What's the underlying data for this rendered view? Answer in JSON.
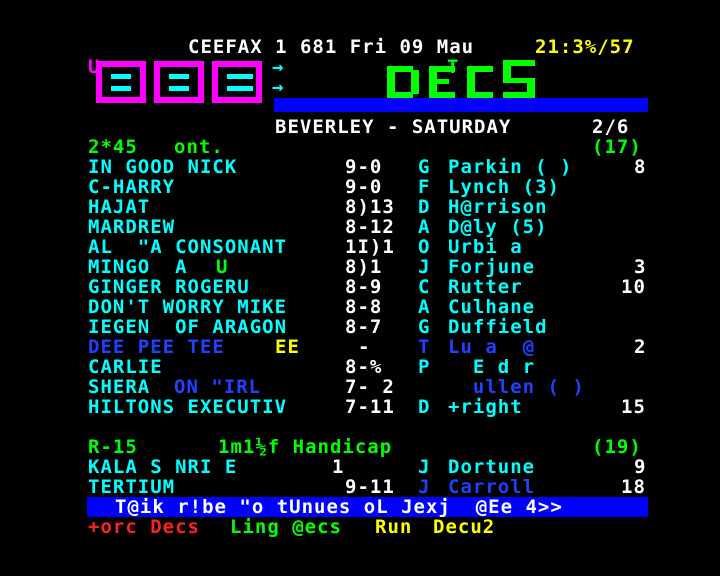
{
  "header": {
    "service": "CEEFAX 1 681 Fri 09 Mau",
    "clock": "21:3%/57"
  },
  "logos": {
    "bbc_prefix": "U",
    "bbc_arrows": [
      "→",
      "→"
    ],
    "section_superscript": "T",
    "section": "DECS"
  },
  "page": {
    "title": "BEVERLEY - SATURDAY",
    "page_number": "2/6"
  },
  "race1": {
    "time": "2*45",
    "label": "ont.",
    "runners": "(17)",
    "horses": [
      {
        "name": "IN GOOD NICK",
        "weight": "9-0",
        "draw": "G",
        "jockey": "Parkin ( )",
        "odds": "8"
      },
      {
        "name": "C-HARRY",
        "weight": "9-0",
        "draw": "F",
        "jockey": "Lynch (3)",
        "odds": ""
      },
      {
        "name": "HAJAT",
        "weight": "8)13",
        "draw": "D",
        "jockey": "H@rrison",
        "odds": ""
      },
      {
        "name": "MARDREW",
        "weight": "8-12",
        "draw": "A",
        "jockey": "D@ly (5)",
        "odds": ""
      },
      {
        "name": "AL  \"A CONSONANT",
        "weight": "1I)1",
        "draw": "O",
        "jockey": "Urbi a",
        "odds": ""
      },
      {
        "name": "MINGO  A ",
        "name_extra": "U",
        "weight": "8)1",
        "draw": "J",
        "jockey": "Forjune",
        "odds": "3"
      },
      {
        "name": "GINGER ROGERU",
        "weight": "8-9",
        "draw": "C",
        "jockey": "Rutter",
        "odds": "10"
      },
      {
        "name": "DON'T WORRY MIKE",
        "weight": "8-8",
        "draw": "A",
        "jockey": "Culhane",
        "odds": ""
      },
      {
        "name": "IEGEN  OF ARAGON",
        "weight": "8-7",
        "draw": "G",
        "jockey": "Duffield",
        "odds": ""
      },
      {
        "name": "DEE PEE TEE",
        "name_extra": "EE",
        "weight": "-",
        "draw": "T",
        "jockey": "Lu a  @",
        "odds": "2"
      },
      {
        "name": "CARLIE",
        "weight": "8-%",
        "draw": "P",
        "jockey": "  E d r",
        "odds": ""
      },
      {
        "name": "SHERA",
        "name_extra": "ON \"IRL",
        "weight": "7- 2",
        "draw": "",
        "jockey": "  ullen ( )",
        "odds": ""
      },
      {
        "name": "HILTONS EXECUTIV",
        "weight": "7-11",
        "draw": "D",
        "jockey": "+right",
        "odds": "15"
      }
    ]
  },
  "race2": {
    "race_id": "R-15",
    "title": "1m1½f Handicap",
    "runners": "(19)",
    "horses": [
      {
        "name": "KALA S NRI E",
        "weight": "1",
        "draw": "J",
        "jockey": "Dortune",
        "odds": "9"
      },
      {
        "name": "TERTIUM",
        "weight": "9-11",
        "draw": "J",
        "jockey": "Carroll",
        "odds": "18"
      }
    ]
  },
  "navbar": {
    "text": "T@ik r!be \"o tUnues oL Jexj  @Ee 4>>"
  },
  "fastext": {
    "red": "+orc Decs",
    "green": "Ling @ecs",
    "yellow": "Run",
    "cyan": "Decu2"
  },
  "colors": {
    "background": "#000000",
    "bbc_logo": "#ff00ff",
    "section_logo": "#00ff00",
    "band": "#0000ff"
  }
}
